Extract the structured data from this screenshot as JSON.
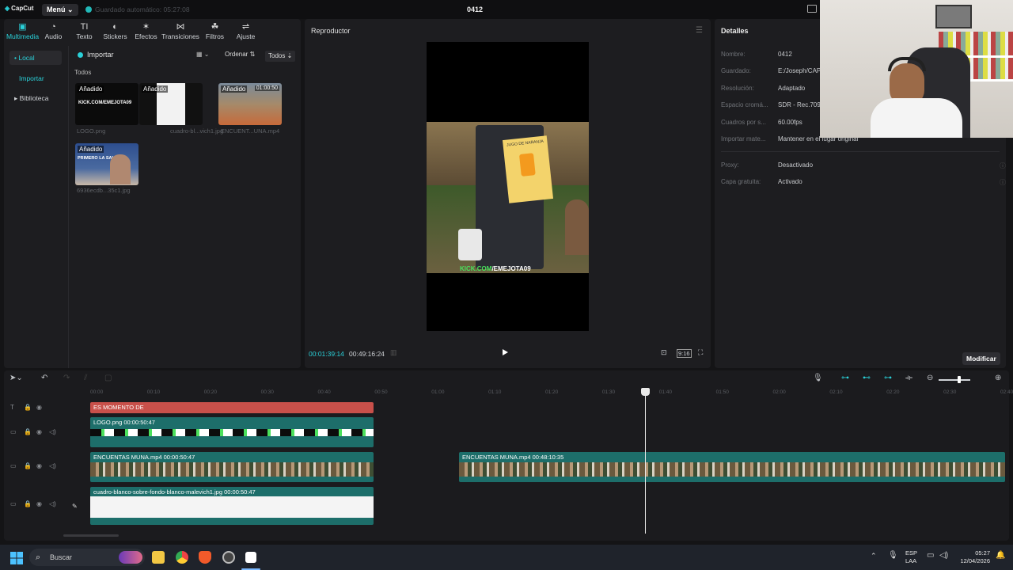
{
  "app": {
    "name": "CapCut",
    "menu_label": "Menú",
    "autosave": "Guardado automático: 05:27:08",
    "project_title": "0412"
  },
  "media_tabs": [
    {
      "label": "Multimedia",
      "icon": "media-icon",
      "glyph": "▣"
    },
    {
      "label": "Audio",
      "icon": "audio-icon",
      "glyph": "◔"
    },
    {
      "label": "Texto",
      "icon": "text-icon",
      "glyph": "TI"
    },
    {
      "label": "Stickers",
      "icon": "sticker-icon",
      "glyph": "◐"
    },
    {
      "label": "Efectos",
      "icon": "effects-icon",
      "glyph": "✶"
    },
    {
      "label": "Transiciones",
      "icon": "transitions-icon",
      "glyph": "⋈"
    },
    {
      "label": "Filtros",
      "icon": "filters-icon",
      "glyph": "☘"
    },
    {
      "label": "Ajuste",
      "icon": "adjust-icon",
      "glyph": "⇌"
    }
  ],
  "side_nav": {
    "local": "Local",
    "import": "Importar",
    "library": "Biblioteca"
  },
  "library": {
    "import_label": "Importar",
    "order_label": "Ordenar",
    "all_label": "Todos",
    "section_label": "Todos",
    "items": [
      {
        "badge": "Añadido",
        "caption": "LOGO.png",
        "extra": "KICK.COM/EMEJOTA09"
      },
      {
        "badge": "Añadido",
        "caption": "cuadro-bl...vich1.jpg",
        "extra": ""
      },
      {
        "badge": "Añadido",
        "caption": "ENCUENT...UNA.mp4",
        "extra": "01:00:50"
      },
      {
        "badge": "Añadido",
        "caption": "6936ecdb...35c1.jpg",
        "extra": "PRIMERO LA SALUD"
      }
    ]
  },
  "player": {
    "title": "Reproductor",
    "overlay_prefix": "KICK.COM",
    "overlay_suffix": "/EMEJOTA09",
    "sign_text": "JUGO DE NARANJA",
    "current_time": "00:01:39:14",
    "total_time": "00:49:16:24",
    "ratio_label": "9:16"
  },
  "details": {
    "title": "Detalles",
    "rows": [
      {
        "label": "Nombre:",
        "value": "0412"
      },
      {
        "label": "Guardado:",
        "value": "E:/Joseph/CAP"
      },
      {
        "label": "Resolución:",
        "value": "Adaptado"
      },
      {
        "label": "Espacio cromá...",
        "value": "SDR - Rec.709"
      },
      {
        "label": "Cuadros por s...",
        "value": "60.00fps"
      },
      {
        "label": "Importar mate...",
        "value": "Mantener en el lugar original"
      },
      {
        "label": "Proxy:",
        "value": "Desactivado"
      },
      {
        "label": "Capa gratuita:",
        "value": "Activado"
      }
    ],
    "modify_label": "Modificar"
  },
  "timeline": {
    "ruler": [
      "00:00",
      "00:10",
      "00:20",
      "00:30",
      "00:40",
      "00:50",
      "01:00",
      "01:10",
      "01:20",
      "01:30",
      "01:40",
      "01:50",
      "02:00",
      "02:10",
      "02:20",
      "02:30",
      "02:40"
    ],
    "text_clip": "ES MOMENTO DE",
    "logo_clip": "LOGO.png  00:00:50:47",
    "video_clip_1": "ENCUENTAS MUNA.mp4  00:00:50:47",
    "video_clip_2": "ENCUENTAS MUNA.mp4  00:48:10:35",
    "image_clip": "cuadro-blanco-sobre-fondo-blanco-malevich1.jpg  00:00:50:47"
  },
  "taskbar": {
    "search": "Buscar",
    "lang_1": "ESP",
    "lang_2": "LAA",
    "time": "05:27",
    "date": "12/04/2026"
  },
  "colors": {
    "accent": "#2ad0d8",
    "text_clip": "#c8504a",
    "track_teal": "#1d6e6a"
  }
}
